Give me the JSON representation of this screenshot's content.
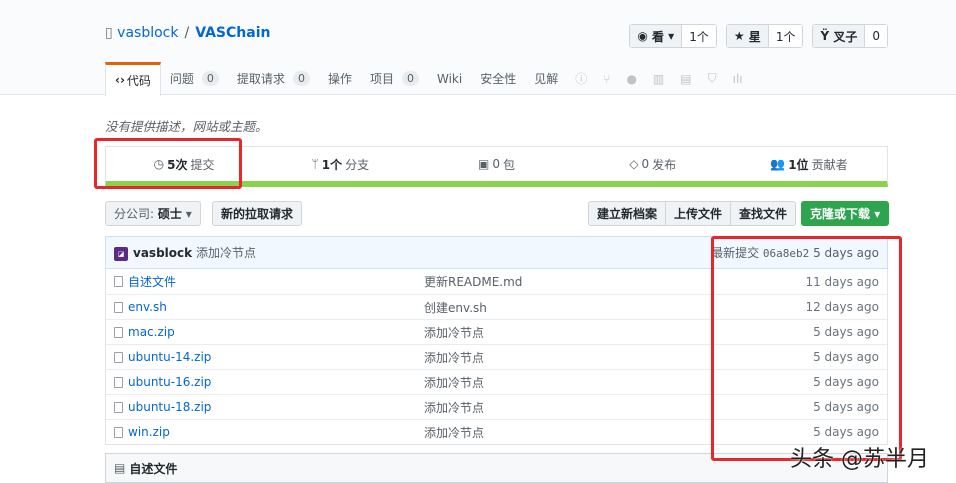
{
  "repo": {
    "owner": "vasblock",
    "sep": "/",
    "name": "VASChain"
  },
  "actions": [
    {
      "label": "看",
      "count": "1个",
      "icon": "eye-icon"
    },
    {
      "label": "星",
      "count": "1个",
      "icon": "star-icon"
    },
    {
      "label": "叉子",
      "count": "0",
      "icon": "fork-icon"
    }
  ],
  "tabs": [
    {
      "label": "代码"
    },
    {
      "label": "问题",
      "count": "0"
    },
    {
      "label": "提取请求",
      "count": "0"
    },
    {
      "label": "操作"
    },
    {
      "label": "项目",
      "count": "0"
    },
    {
      "label": "Wiki"
    },
    {
      "label": "安全性"
    },
    {
      "label": "见解"
    }
  ],
  "description": "没有提供描述，网站或主题。",
  "summary": [
    {
      "num": "5次",
      "label": "提交"
    },
    {
      "num": "1个",
      "label": "分支"
    },
    {
      "num": "0",
      "label": "包"
    },
    {
      "num": "0",
      "label": "发布"
    },
    {
      "num": "1位",
      "label": "贡献者"
    }
  ],
  "branch": {
    "label": "分公司:",
    "value": "硕士"
  },
  "buttons": {
    "new_pr": "新的拉取请求",
    "create": "建立新档案",
    "upload": "上传文件",
    "find": "查找文件",
    "clone": "克隆或下载"
  },
  "commit": {
    "author": "vasblock",
    "message": "添加冷节点",
    "latest_label": "最新提交",
    "sha": "06a8eb2",
    "time": "5 days ago"
  },
  "files": [
    {
      "name": "自述文件",
      "message": "更新README.md",
      "age": "11 days ago"
    },
    {
      "name": "env.sh",
      "message": "创建env.sh",
      "age": "12 days ago"
    },
    {
      "name": "mac.zip",
      "message": "添加冷节点",
      "age": "5 days ago"
    },
    {
      "name": "ubuntu-14.zip",
      "message": "添加冷节点",
      "age": "5 days ago"
    },
    {
      "name": "ubuntu-16.zip",
      "message": "添加冷节点",
      "age": "5 days ago"
    },
    {
      "name": "ubuntu-18.zip",
      "message": "添加冷节点",
      "age": "5 days ago"
    },
    {
      "name": "win.zip",
      "message": "添加冷节点",
      "age": "5 days ago"
    }
  ],
  "readme": "自述文件",
  "watermark": "头条 @苏半月"
}
